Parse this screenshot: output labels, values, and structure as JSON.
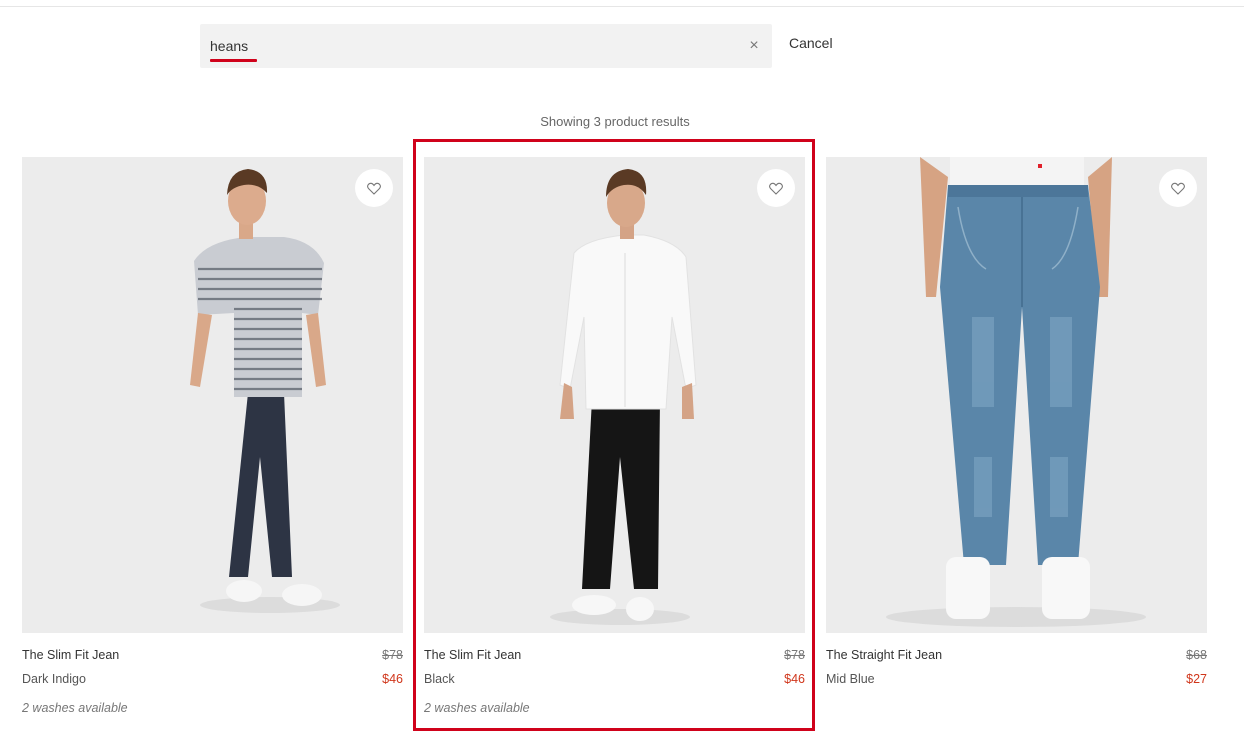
{
  "search": {
    "value": "heans",
    "clear_symbol": "×",
    "cancel_label": "Cancel"
  },
  "results": {
    "summary": "Showing 3 product results"
  },
  "colors": {
    "accent": "#d0021b",
    "sale": "#d0361b"
  },
  "products": [
    {
      "name": "The Slim Fit Jean",
      "color": "Dark Indigo",
      "original_price": "$78",
      "sale_price": "$46",
      "washes": "2 washes available",
      "wishlist_icon": "heart-icon"
    },
    {
      "name": "The Slim Fit Jean",
      "color": "Black",
      "original_price": "$78",
      "sale_price": "$46",
      "washes": "2 washes available",
      "wishlist_icon": "heart-icon"
    },
    {
      "name": "The Straight Fit Jean",
      "color": "Mid Blue",
      "original_price": "$68",
      "sale_price": "$27",
      "wishlist_icon": "heart-icon"
    }
  ]
}
